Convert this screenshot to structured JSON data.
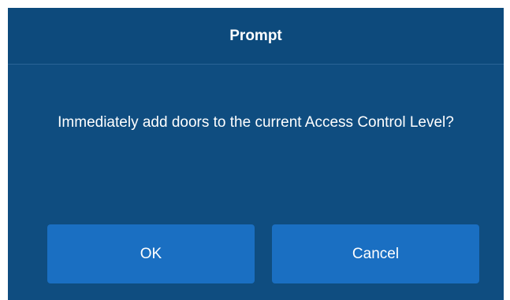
{
  "dialog": {
    "title": "Prompt",
    "message": "Immediately add doors to the current Access Control Level?",
    "ok_label": "OK",
    "cancel_label": "Cancel"
  },
  "colors": {
    "dialog_background": "#0f4d80",
    "header_background": "#0d4a7c",
    "button_background": "#1a6fc2",
    "text": "#ffffff"
  }
}
